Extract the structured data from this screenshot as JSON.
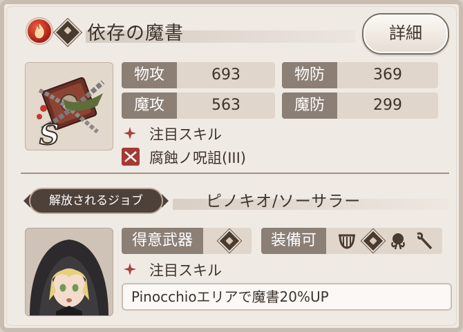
{
  "header": {
    "element_icon": "fire-element-icon",
    "category_icon": "tome-icon",
    "title": "依存の魔書",
    "detail_button": "詳細"
  },
  "item": {
    "rank": "S",
    "icon": "chained-tome-icon"
  },
  "stats": [
    {
      "label": "物攻",
      "value": "693"
    },
    {
      "label": "物防",
      "value": "369"
    },
    {
      "label": "魔攻",
      "value": "563"
    },
    {
      "label": "魔防",
      "value": "299"
    }
  ],
  "skills": {
    "featured_label": "注目スキル",
    "curse_label": "腐蝕ノ呪詛(III)"
  },
  "unlock": {
    "tag": "解放されるジョブ",
    "job_name": "ピノキオ/ソーサラー"
  },
  "job": {
    "weapon_label": "得意武器",
    "weapon_icon": "tome-icon",
    "equip_label": "装備可",
    "equip_icons": [
      "harp-icon",
      "tome-icon",
      "orb-icon",
      "staff-icon"
    ],
    "featured_label": "注目スキル",
    "skill_desc": "Pinocchioエリアで魔書20%UP"
  },
  "colors": {
    "label_bg": "#8b7f76",
    "panel_bg": "#f0eae4",
    "accent_red": "#a33a34"
  }
}
